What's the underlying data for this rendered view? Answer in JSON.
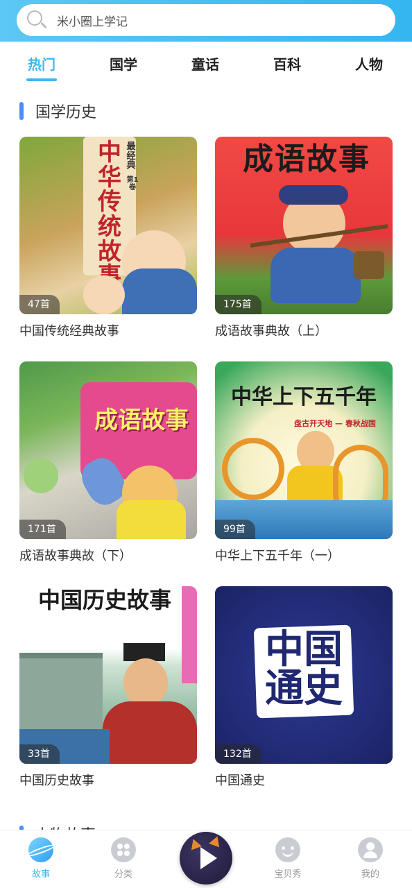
{
  "search": {
    "placeholder": "米小圈上学记"
  },
  "tabs": [
    {
      "label": "热门",
      "active": true
    },
    {
      "label": "国学"
    },
    {
      "label": "童话"
    },
    {
      "label": "百科"
    },
    {
      "label": "人物"
    }
  ],
  "section": {
    "title": "国学历史"
  },
  "cards": [
    {
      "title": "中国传统经典故事",
      "count": "47首",
      "cover_text": "中华传统故事",
      "cover_sub": "最经典",
      "cover_vol": "第1卷"
    },
    {
      "title": "成语故事典故（上）",
      "count": "175首",
      "cover_text": "成语故事"
    },
    {
      "title": "成语故事典故（下）",
      "count": "171首",
      "cover_text": "成语故事"
    },
    {
      "title": "中华上下五千年（一）",
      "count": "99首",
      "cover_text": "中华上下五千年",
      "cover_sub": "盘古开天地 — 春秋战国"
    },
    {
      "title": "中国历史故事",
      "count": "33首",
      "cover_text": "中国历史故事"
    },
    {
      "title": "中国通史",
      "count": "132首",
      "cover_text": "中国通史"
    }
  ],
  "next_section": {
    "title": "人物故事"
  },
  "bottom_nav": [
    {
      "label": "故事",
      "icon": "planet-icon",
      "active": true
    },
    {
      "label": "分类",
      "icon": "grid-icon"
    },
    {
      "label": "",
      "icon": "play-icon"
    },
    {
      "label": "宝贝秀",
      "icon": "face-icon"
    },
    {
      "label": "我的",
      "icon": "user-icon"
    }
  ],
  "colors": {
    "accent": "#3cb8ef",
    "section_bar": "#4a8ff5",
    "header": "#40bbf1"
  }
}
